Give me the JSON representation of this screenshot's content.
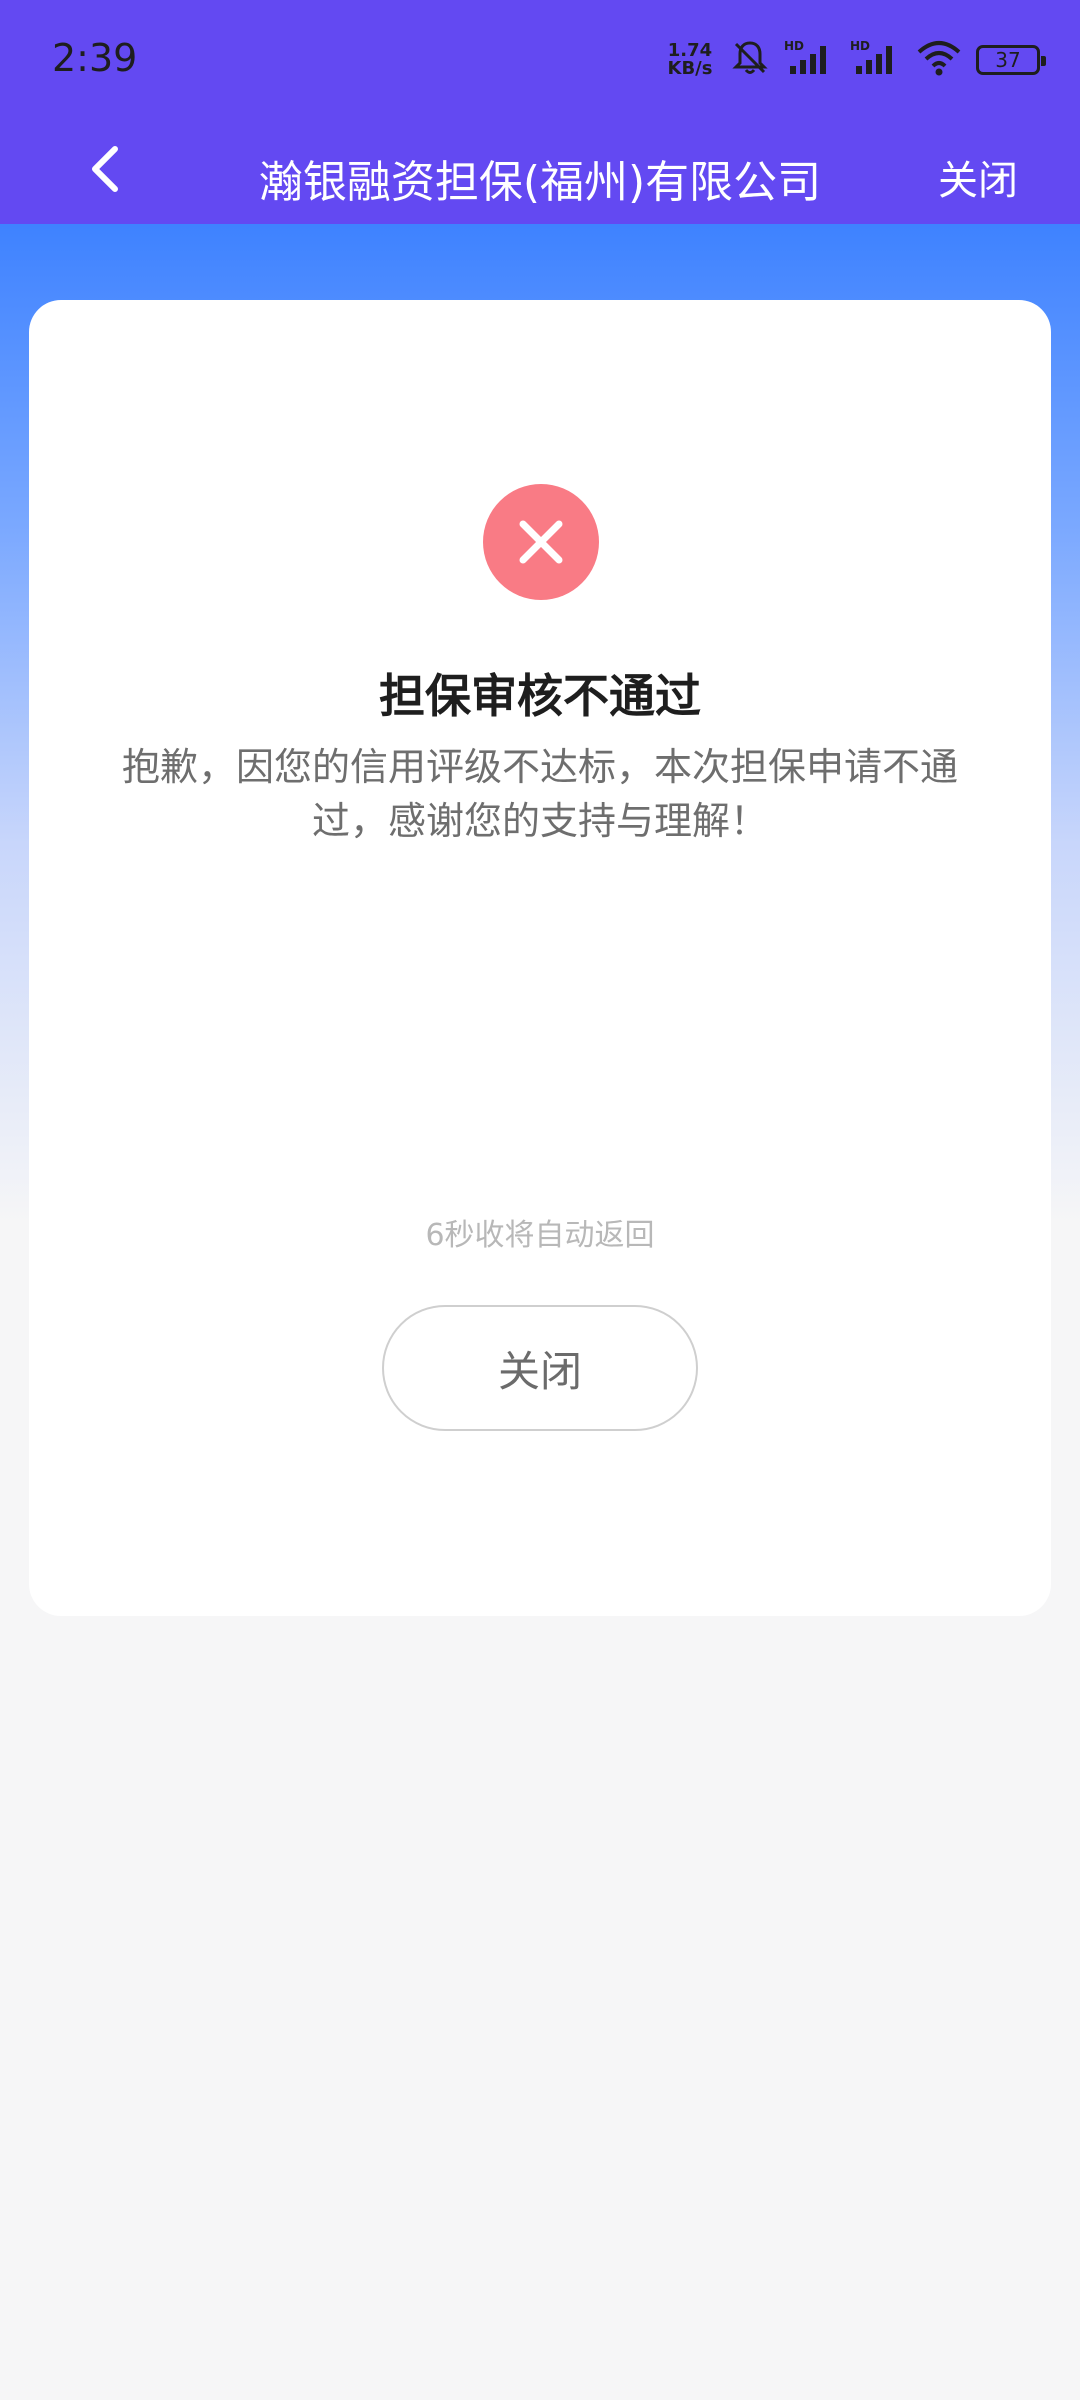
{
  "status_bar": {
    "time": "2:39",
    "net_speed_value": "1.74",
    "net_speed_unit": "KB/s",
    "battery": "37",
    "icons": [
      "mute-bell-icon",
      "signal-hd-icon",
      "signal-hd-icon",
      "wifi-icon",
      "battery-icon"
    ]
  },
  "header": {
    "title": "瀚银融资担保(福州)有限公司",
    "close_label": "关闭",
    "back_icon": "chevron-left-icon"
  },
  "result": {
    "icon": "close-circle-icon",
    "title": "担保审核不通过",
    "message": "抱歉，因您的信用评级不达标，本次担保申请不通过，感谢您的支持与理解！",
    "countdown": "6秒收将自动返回",
    "close_button_label": "关闭"
  },
  "colors": {
    "header_bg": "#6349f2",
    "gradient_top": "#3e82ff",
    "error_red": "#f97b85",
    "page_bg": "#f6f6f7"
  }
}
